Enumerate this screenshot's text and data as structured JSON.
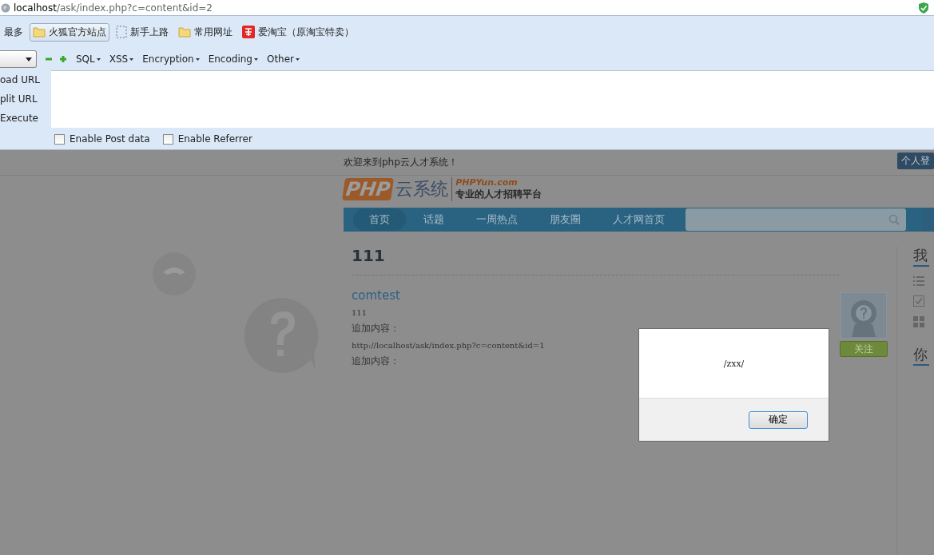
{
  "address_bar": {
    "host": "localhost",
    "path": "/ask/index.php?c=content&id=2"
  },
  "bookmarks": [
    {
      "label": "最多",
      "selected": false
    },
    {
      "label": "火狐官方站点",
      "selected": true
    },
    {
      "label": "新手上路",
      "selected": false
    },
    {
      "label": "常用网址",
      "selected": false
    },
    {
      "label": "爱淘宝（原淘宝特卖）",
      "selected": false
    }
  ],
  "hackbar": {
    "menus": [
      "SQL",
      "XSS",
      "Encryption",
      "Encoding",
      "Other"
    ],
    "actions": [
      "oad URL",
      "plit URL",
      "Execute"
    ],
    "options": [
      {
        "label": "Enable Post data",
        "checked": false
      },
      {
        "label": "Enable Referrer",
        "checked": false
      }
    ]
  },
  "page": {
    "welcome": "欢迎来到php云人才系统！",
    "login_button": "个人登",
    "logo": {
      "mark": "PHP",
      "name": "云系统",
      "domain": "PHPYun.com",
      "slogan": "专业的人才招聘平台"
    },
    "nav": [
      {
        "label": "首页",
        "selected": true
      },
      {
        "label": "话题",
        "selected": false
      },
      {
        "label": "一周热点",
        "selected": false
      },
      {
        "label": "朋友圈",
        "selected": false
      },
      {
        "label": "人才网首页",
        "selected": false
      }
    ],
    "question": {
      "title": "111",
      "author": "comtest",
      "body": "111",
      "lines": [
        {
          "kind": "label",
          "text": "追加内容："
        },
        {
          "kind": "url",
          "text": "http://localhost/ask/index.php?c=content&id=1"
        },
        {
          "kind": "label",
          "text": "追加内容："
        }
      ]
    },
    "follow_button": "关注",
    "sidebar_headings": [
      "我",
      "你"
    ]
  },
  "dialog": {
    "message": "/zxx/",
    "button": "确定"
  }
}
